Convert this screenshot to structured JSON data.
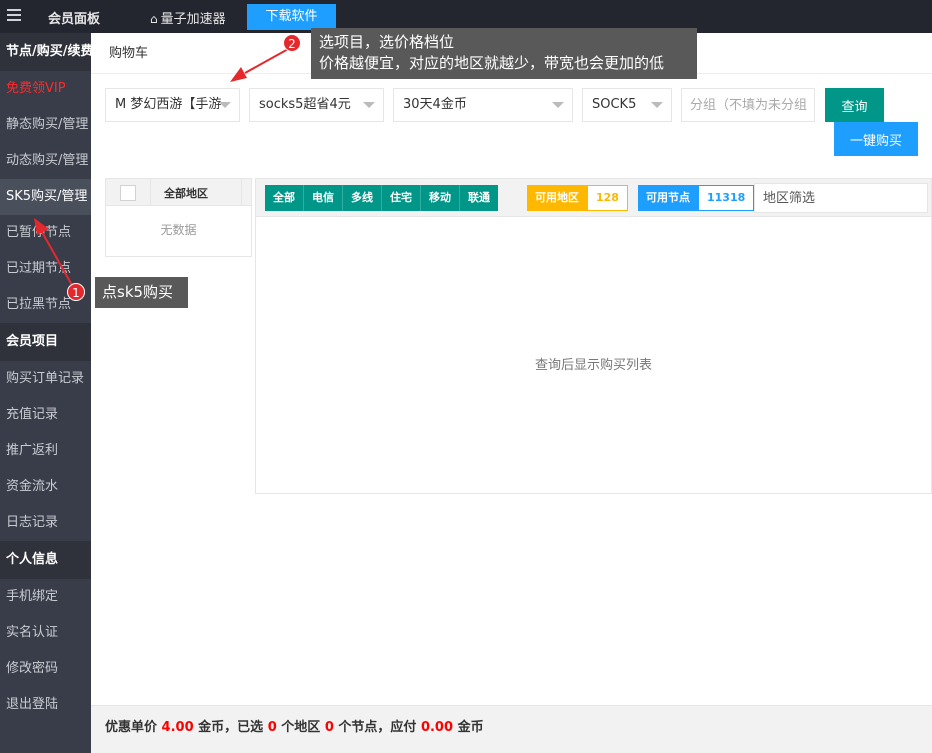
{
  "topbar": {
    "brand": "会员面板",
    "accelerator": "量子加速器",
    "download": "下载软件"
  },
  "sidebar": {
    "sections": [
      {
        "title": "节点/购买/续费",
        "items": [
          {
            "label": "免费领VIP"
          },
          {
            "label": "静态购买/管理"
          },
          {
            "label": "动态购买/管理"
          },
          {
            "label": "SK5购买/管理"
          },
          {
            "label": "已暂停节点"
          },
          {
            "label": "已过期节点"
          },
          {
            "label": "已拉黑节点"
          }
        ]
      },
      {
        "title": "会员项目",
        "items": [
          {
            "label": "购买订单记录"
          },
          {
            "label": "充值记录"
          },
          {
            "label": "推广返利"
          },
          {
            "label": "资金流水"
          },
          {
            "label": "日志记录"
          }
        ]
      },
      {
        "title": "个人信息",
        "items": [
          {
            "label": "手机绑定"
          },
          {
            "label": "实名认证"
          },
          {
            "label": "修改密码"
          },
          {
            "label": "退出登陆"
          }
        ]
      }
    ]
  },
  "cart": {
    "title": "购物车",
    "selects": {
      "project": "M 梦幻西游【手游",
      "package": "socks5超省4元",
      "duration": "30天4金币",
      "protocol": "SOCK5"
    },
    "group_placeholder": "分组（不填为未分组",
    "query_label": "查询",
    "buy_label": "一键购买"
  },
  "region_table": {
    "header": "全部地区",
    "empty": "无数据"
  },
  "node_panel": {
    "tabs": [
      "全部",
      "电信",
      "多线",
      "住宅",
      "移动",
      "联通"
    ],
    "available_regions_label": "可用地区",
    "available_regions_value": "128",
    "available_nodes_label": "可用节点",
    "available_nodes_value": "11318",
    "filter_placeholder": "地区筛选",
    "message": "查询后显示购买列表"
  },
  "footer": {
    "unit_label": "优惠单价",
    "unit_price": "4.00",
    "coin": "金币，已选",
    "regions_count": "0",
    "regions_label": "个地区",
    "nodes_count": "0",
    "nodes_label": "个节点，应付",
    "total": "0.00",
    "coin2": "金币"
  },
  "annotations": {
    "step1_num": "1",
    "step1_text": "点sk5购买",
    "step2_num": "2",
    "step2_line1": "选项目，选价格档位",
    "step2_line2": "价格越便宜，对应的地区就越少，带宽也会更加的低"
  }
}
